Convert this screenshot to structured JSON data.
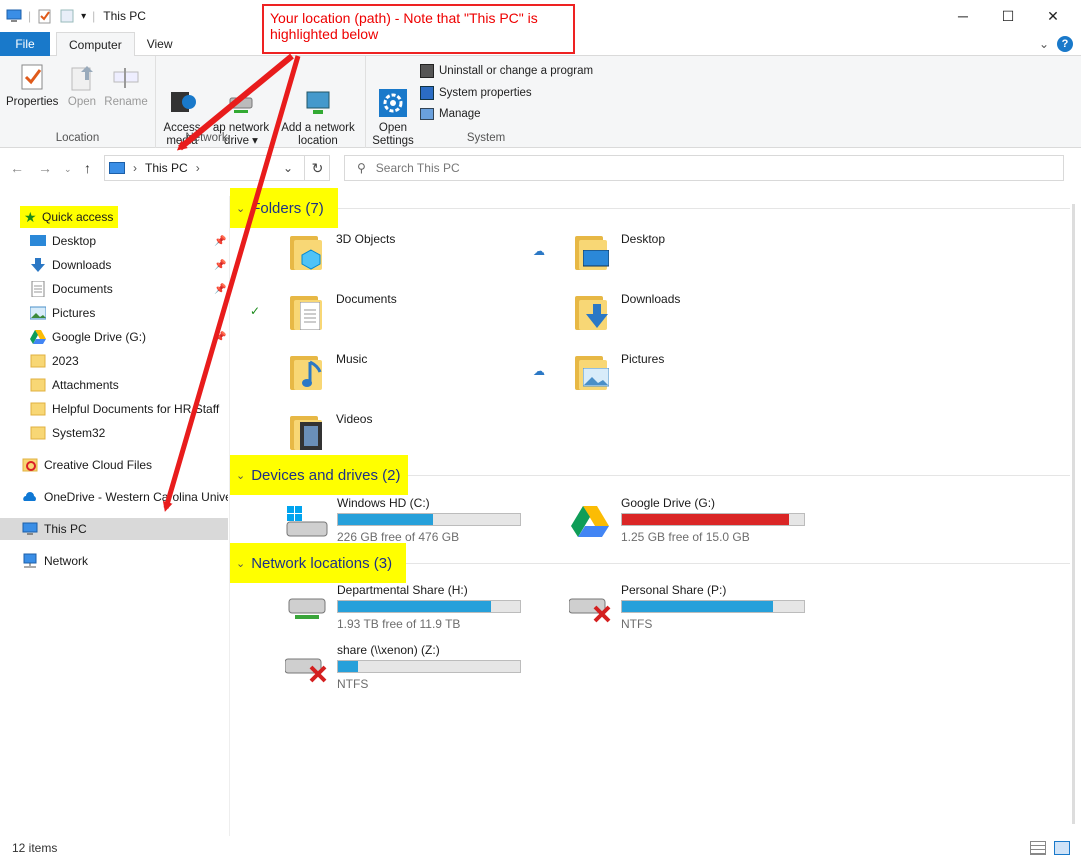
{
  "window": {
    "title": "This PC",
    "minimize_glyph": "─",
    "maximize_glyph": "☐",
    "close_glyph": "✕"
  },
  "ribbon_tabs": [
    {
      "label": "File"
    },
    {
      "label": "Computer"
    },
    {
      "label": "View"
    }
  ],
  "ribbon": {
    "location_group": {
      "label": "Location",
      "buttons": [
        {
          "label": "Properties",
          "icon": "properties-icon"
        },
        {
          "label": "Open",
          "icon": "open-icon"
        },
        {
          "label": "Rename",
          "icon": "rename-icon"
        }
      ]
    },
    "network_group": {
      "label": "Network",
      "buttons": [
        {
          "label": "Access\nmedia",
          "icon": "access-media-icon"
        },
        {
          "label": "ap network\ndrive ▾",
          "icon": "map-network-drive-icon"
        },
        {
          "label": "Add a network\nlocation",
          "icon": "add-network-location-icon"
        }
      ]
    },
    "system_group": {
      "label": "System",
      "open_settings": "Open\nSettings",
      "items": [
        {
          "label": "Uninstall or change a program"
        },
        {
          "label": "System properties"
        },
        {
          "label": "Manage"
        }
      ]
    }
  },
  "address": {
    "path": "This PC",
    "separator": "›",
    "search_placeholder": "Search This PC"
  },
  "nav_pane": {
    "quick_access": "Quick access",
    "items": [
      {
        "label": "Desktop",
        "pinned": true
      },
      {
        "label": "Downloads",
        "pinned": true
      },
      {
        "label": "Documents",
        "pinned": true
      },
      {
        "label": "Pictures",
        "pinned": true
      },
      {
        "label": "Google Drive (G:)",
        "pinned": true
      },
      {
        "label": "2023"
      },
      {
        "label": "Attachments"
      },
      {
        "label": "Helpful Documents for HR Staff"
      },
      {
        "label": "System32"
      }
    ],
    "creative_cloud": "Creative Cloud Files",
    "onedrive": "OneDrive - Western Carolina Univer",
    "this_pc": "This PC",
    "network": "Network"
  },
  "sections": {
    "folders": "Folders (7)",
    "devices": "Devices and drives (2)",
    "network": "Network locations (3)"
  },
  "folders": [
    {
      "label": "3D Objects"
    },
    {
      "label": "Desktop"
    },
    {
      "label": "Documents"
    },
    {
      "label": "Downloads"
    },
    {
      "label": "Music"
    },
    {
      "label": "Pictures"
    },
    {
      "label": "Videos"
    }
  ],
  "drives": [
    {
      "label": "Windows HD (C:)",
      "sub": "226 GB free of 476 GB",
      "used_fraction": 0.52,
      "color": "#26a0da"
    },
    {
      "label": "Google Drive (G:)",
      "sub": "1.25 GB free of 15.0 GB",
      "used_fraction": 0.92,
      "color": "#da2626"
    }
  ],
  "network_locations": [
    {
      "label": "Departmental Share (H:)",
      "sub": "1.93 TB free of 11.9 TB",
      "used_fraction": 0.84
    },
    {
      "label": "Personal Share (P:)",
      "sub": "NTFS",
      "used_fraction": 0.83
    },
    {
      "label": "share (\\\\xenon) (Z:)",
      "sub": "NTFS",
      "used_fraction": 0.11
    }
  ],
  "status": {
    "items": "12 items"
  },
  "annotation": {
    "callout": "Your location (path) - Note that \"This PC\" is highlighted below"
  },
  "colors": {
    "accent": "#1979ca",
    "highlight": "#ffff00",
    "arrow": "#e81c1c"
  }
}
